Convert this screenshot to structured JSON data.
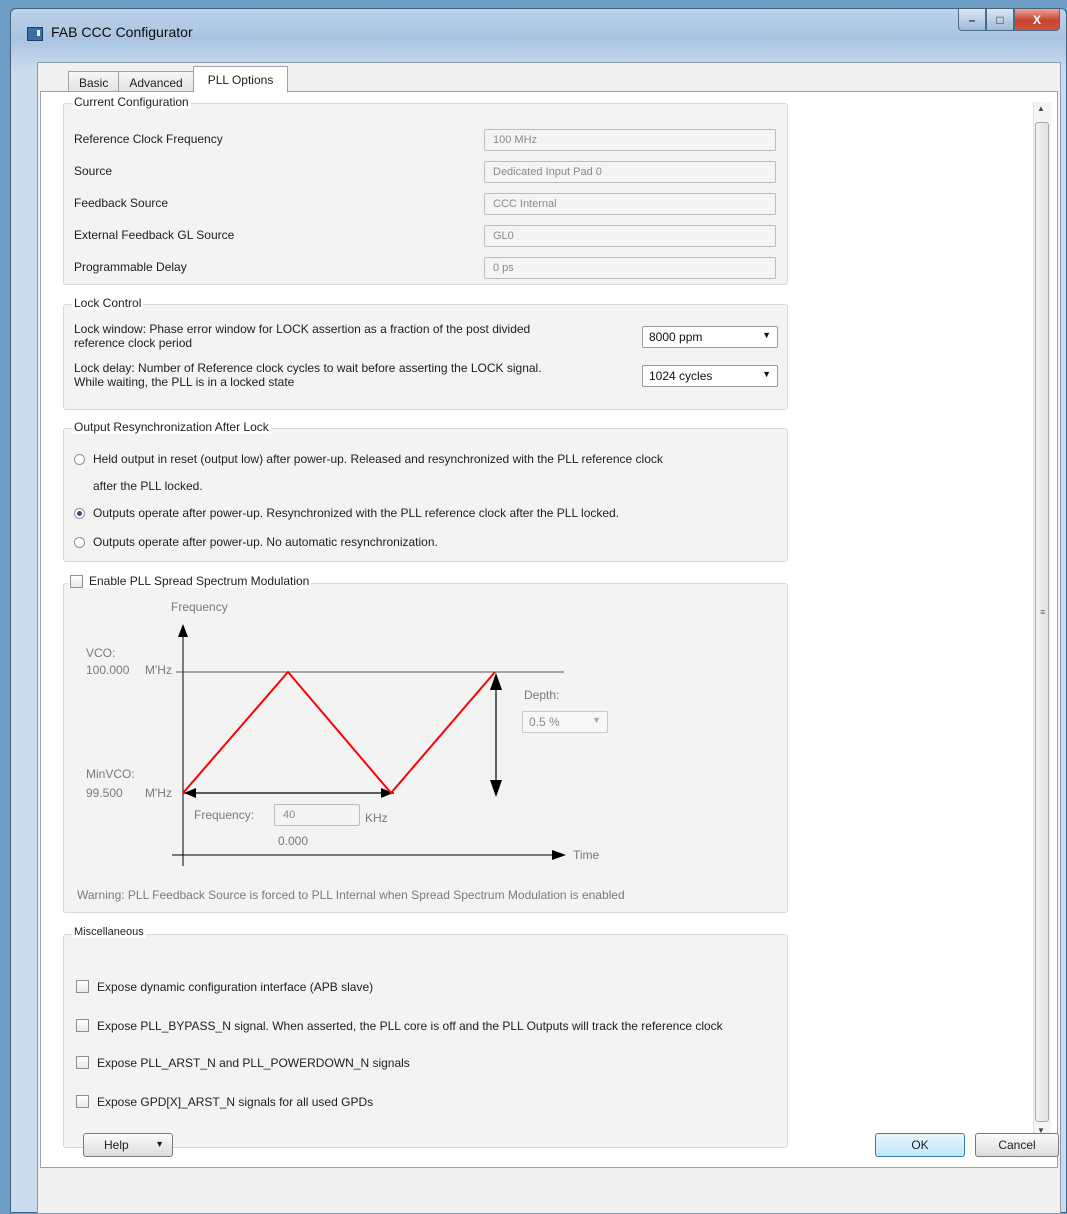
{
  "window": {
    "title": "FAB CCC Configurator",
    "controls": [
      "–",
      "□",
      "X"
    ]
  },
  "tabs": [
    {
      "label": "Basic",
      "active": false
    },
    {
      "label": "Advanced",
      "active": false
    },
    {
      "label": "PLL Options",
      "active": true
    }
  ],
  "current_config": {
    "legend": "Current Configuration",
    "rows": [
      {
        "label": "Reference Clock Frequency",
        "value": "100 MHz"
      },
      {
        "label": "Source",
        "value": "Dedicated Input Pad 0"
      },
      {
        "label": "Feedback Source",
        "value": "CCC Internal"
      },
      {
        "label": "External Feedback GL Source",
        "value": "GL0"
      },
      {
        "label": "Programmable Delay",
        "value": "0 ps"
      }
    ]
  },
  "lock_control": {
    "legend": "Lock Control",
    "lock_window_text_1": "Lock window: Phase error window for LOCK assertion as a fraction of the post divided",
    "lock_window_text_2": "reference clock period",
    "lock_window_value": "8000 ppm",
    "lock_delay_text_1": "Lock delay: Number of Reference clock cycles to wait before asserting the LOCK signal.",
    "lock_delay_text_2": "While waiting, the PLL is in a locked state",
    "lock_delay_value": "1024 cycles"
  },
  "output_resync": {
    "legend": "Output Resynchronization After Lock",
    "options": [
      {
        "line1": "Held output in reset (output low) after power-up. Released and resynchronized with the PLL reference clock",
        "line2": "after the PLL locked.",
        "selected": false
      },
      {
        "line1": "Outputs operate after power-up. Resynchronized with the PLL reference clock after the PLL locked.",
        "selected": true
      },
      {
        "line1": "Outputs operate after power-up. No automatic resynchronization.",
        "selected": false
      }
    ]
  },
  "spread_spectrum": {
    "checkbox_label": "Enable PLL Spread Spectrum Modulation",
    "checked": false,
    "y_axis_label": "Frequency",
    "x_axis_label": "Time",
    "vco_label": "VCO:",
    "vco_value": "100.000",
    "min_vco_label": "MinVCO:",
    "min_vco_value": "99.500",
    "unit_mhz": "M'Hz",
    "depth_label": "Depth:",
    "depth_value": "0.5 %",
    "frequency_label": "Frequency:",
    "frequency_value": "40",
    "frequency_unit": "KHz",
    "frequency_readout": "0.000",
    "warning": "Warning: PLL Feedback Source is forced to PLL Internal when Spread Spectrum Modulation is enabled",
    "line_color": "#ff0000"
  },
  "misc": {
    "legend": "Miscellaneous",
    "options": [
      {
        "label": "Expose dynamic configuration interface (APB slave)",
        "checked": false
      },
      {
        "label": "Expose PLL_BYPASS_N signal. When asserted, the PLL core is off and the PLL Outputs will track the reference clock",
        "checked": false
      },
      {
        "label": "Expose PLL_ARST_N and PLL_POWERDOWN_N signals",
        "checked": false
      },
      {
        "label": "Expose GPD[X]_ARST_N signals for all used GPDs",
        "checked": false
      }
    ]
  },
  "footer": {
    "help_label": "Help",
    "ok_label": "OK",
    "cancel_label": "Cancel"
  }
}
